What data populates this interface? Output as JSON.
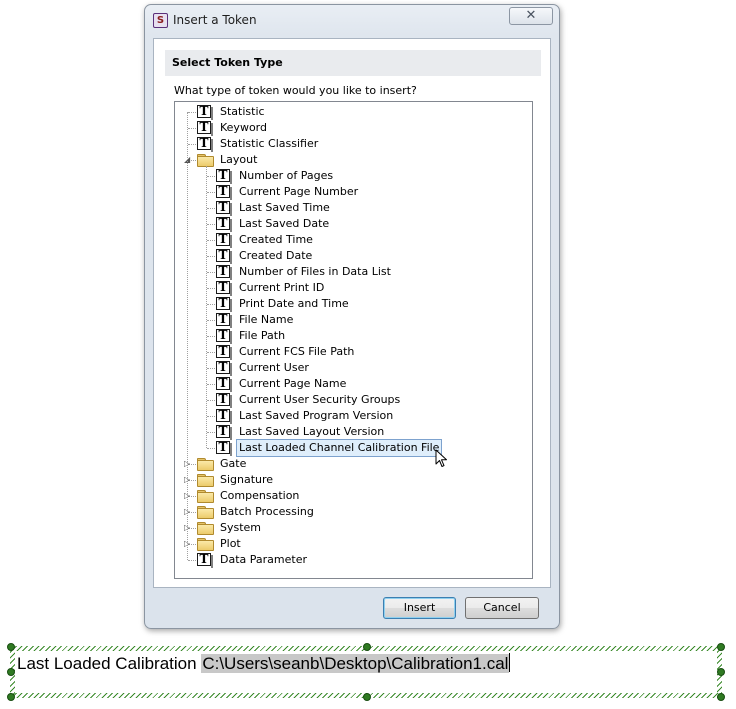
{
  "dialog": {
    "title": "Insert a Token",
    "app_icon_glyph": "S",
    "close_glyph": "✕",
    "section_title": "Select Token Type",
    "question": "What type of token would you like to insert?",
    "insert_label": "Insert",
    "cancel_label": "Cancel"
  },
  "tree": {
    "root_items": [
      {
        "label": "Statistic",
        "type": "token"
      },
      {
        "label": "Keyword",
        "type": "token"
      },
      {
        "label": "Statistic Classifier",
        "type": "token"
      },
      {
        "label": "Layout",
        "type": "folder",
        "expanded": true
      }
    ],
    "layout_children": [
      "Number of Pages",
      "Current Page Number",
      "Last Saved Time",
      "Last Saved Date",
      "Created Time",
      "Created Date",
      "Number of Files in Data List",
      "Current Print ID",
      "Print Date and Time",
      "File Name",
      "File Path",
      "Current FCS File Path",
      "Current User",
      "Current Page Name",
      "Current User Security Groups",
      "Last Saved Program Version",
      "Last Saved Layout Version",
      "Last Loaded Channel Calibration File"
    ],
    "selected": "Last Loaded Channel Calibration File",
    "trailing_items": [
      {
        "label": "Gate",
        "type": "folder"
      },
      {
        "label": "Signature",
        "type": "folder"
      },
      {
        "label": "Compensation",
        "type": "folder"
      },
      {
        "label": "Batch Processing",
        "type": "folder"
      },
      {
        "label": "System",
        "type": "folder"
      },
      {
        "label": "Plot",
        "type": "folder"
      },
      {
        "label": "Data Parameter",
        "type": "token"
      }
    ]
  },
  "textbox": {
    "label": "Last Loaded Calibration",
    "token_value": "C:\\Users\\seanb\\Desktop\\Calibration1.cal"
  },
  "icons": {
    "token": "token-t-icon",
    "folder": "folder-icon",
    "expanded": "triangle-down-icon",
    "collapsed": "triangle-right-icon",
    "cursor": "mouse-pointer-icon"
  }
}
